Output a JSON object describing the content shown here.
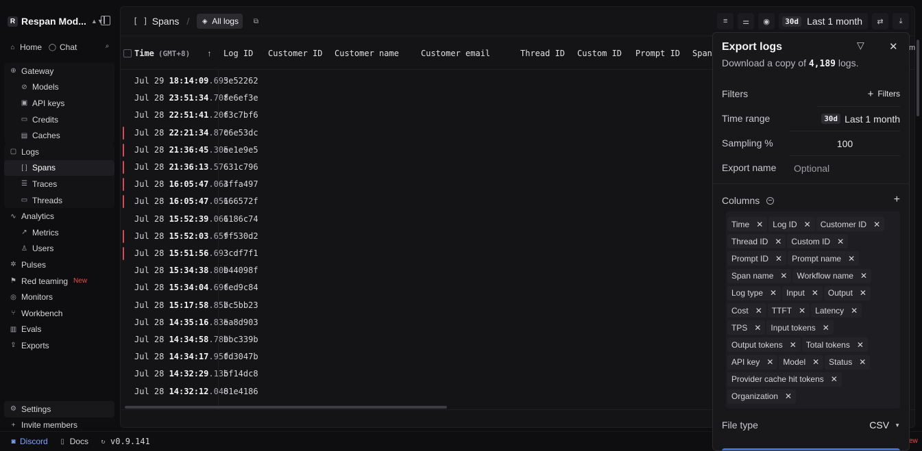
{
  "workspace": {
    "logo_letter": "R",
    "name": "Respan Mod..."
  },
  "quick": {
    "home": "Home",
    "chat": "Chat"
  },
  "nav": {
    "gateway": "Gateway",
    "models": "Models",
    "api_keys": "API keys",
    "credits": "Credits",
    "caches": "Caches",
    "logs": "Logs",
    "spans": "Spans",
    "traces": "Traces",
    "threads": "Threads",
    "analytics": "Analytics",
    "metrics": "Metrics",
    "users": "Users",
    "pulses": "Pulses",
    "red_teaming": "Red teaming",
    "new_badge": "New",
    "monitors": "Monitors",
    "workbench": "Workbench",
    "evals": "Evals",
    "exports": "Exports"
  },
  "bottom": {
    "settings": "Settings",
    "invite": "Invite members"
  },
  "statusbar": {
    "discord": "Discord",
    "docs": "Docs",
    "version": "v0.9.141"
  },
  "topbar": {
    "crumb_icon": "[ ]",
    "crumb": "Spans",
    "tab": "All logs",
    "range_tag": "30d",
    "range_label": "Last 1 month"
  },
  "table": {
    "headers": {
      "time": "Time",
      "tz": "(GMT+8)",
      "log_id": "Log ID",
      "customer_id": "Customer ID",
      "customer_name": "Customer name",
      "customer_email": "Customer email",
      "thread_id": "Thread ID",
      "custom_id": "Custom ID",
      "prompt_id": "Prompt ID",
      "span": "Span"
    },
    "rows": [
      {
        "d": "Jul 29",
        "hms": "18:14:09",
        "ms": ".695",
        "id": "3e52262",
        "err": false
      },
      {
        "d": "Jul 28",
        "hms": "23:51:34",
        "ms": ".708",
        "id": "fe6ef3e",
        "err": false
      },
      {
        "d": "Jul 28",
        "hms": "22:51:41",
        "ms": ".206",
        "id": "f3c7bf6",
        "err": false
      },
      {
        "d": "Jul 28",
        "hms": "22:21:34",
        "ms": ".870",
        "id": "c6e53dc",
        "err": true
      },
      {
        "d": "Jul 28",
        "hms": "21:36:45",
        "ms": ".305",
        "id": "ee1e9e5",
        "err": true
      },
      {
        "d": "Jul 28",
        "hms": "21:36:13",
        "ms": ".576",
        "id": "631c796",
        "err": true
      },
      {
        "d": "Jul 28",
        "hms": "16:05:47",
        "ms": ".064",
        "id": "3ffa497",
        "err": true
      },
      {
        "d": "Jul 28",
        "hms": "16:05:47",
        "ms": ".056",
        "id": "166572f",
        "err": true
      },
      {
        "d": "Jul 28",
        "hms": "15:52:39",
        "ms": ".061",
        "id": "6186c74",
        "err": false
      },
      {
        "d": "Jul 28",
        "hms": "15:52:03",
        "ms": ".659",
        "id": "ff530d2",
        "err": true
      },
      {
        "d": "Jul 28",
        "hms": "15:51:56",
        "ms": ".693",
        "id": "3cdf7f1",
        "err": true
      },
      {
        "d": "Jul 28",
        "hms": "15:34:38",
        "ms": ".809",
        "id": "b44098f",
        "err": false
      },
      {
        "d": "Jul 28",
        "hms": "15:34:04",
        "ms": ".696",
        "id": "fed9c84",
        "err": false
      },
      {
        "d": "Jul 28",
        "hms": "15:17:58",
        "ms": ".857",
        "id": "bc5bb23",
        "err": false
      },
      {
        "d": "Jul 28",
        "hms": "14:35:16",
        "ms": ".835",
        "id": "ea8d903",
        "err": false
      },
      {
        "d": "Jul 28",
        "hms": "14:34:58",
        "ms": ".789",
        "id": "bbc339b",
        "err": false
      },
      {
        "d": "Jul 28",
        "hms": "14:34:17",
        "ms": ".950",
        "id": "fd3047b",
        "err": false
      },
      {
        "d": "Jul 28",
        "hms": "14:32:29",
        "ms": ".135",
        "id": "bf14dc8",
        "err": false
      },
      {
        "d": "Jul 28",
        "hms": "14:32:12",
        "ms": ".040",
        "id": "81e4186",
        "err": false
      }
    ]
  },
  "export_panel": {
    "title": "Export logs",
    "sub_prefix": "Download a copy of ",
    "count": "4,189",
    "sub_suffix": " logs.",
    "filters_label": "Filters",
    "filters_btn": "Filters",
    "time_range_label": "Time range",
    "time_range_tag": "30d",
    "time_range_value": "Last 1 month",
    "sampling_label": "Sampling %",
    "sampling_value": "100",
    "export_name_label": "Export name",
    "export_name_placeholder": "Optional",
    "columns_label": "Columns",
    "columns": [
      [
        "Time",
        "Log ID",
        "Customer ID"
      ],
      [
        "Thread ID",
        "Custom ID"
      ],
      [
        "Prompt ID",
        "Prompt name"
      ],
      [
        "Span name",
        "Workflow name"
      ],
      [
        "Log type",
        "Input",
        "Output"
      ],
      [
        "Cost",
        "TTFT",
        "Latency"
      ],
      [
        "TPS",
        "Input tokens"
      ],
      [
        "Output tokens",
        "Total tokens"
      ],
      [
        "API key",
        "Model",
        "Status"
      ],
      [
        "Provider cache hit tokens"
      ],
      [
        "Organization"
      ]
    ],
    "file_type_label": "File type",
    "file_type_value": "CSV"
  },
  "edge": {
    "right_new": "ew",
    "right_em": "m"
  }
}
